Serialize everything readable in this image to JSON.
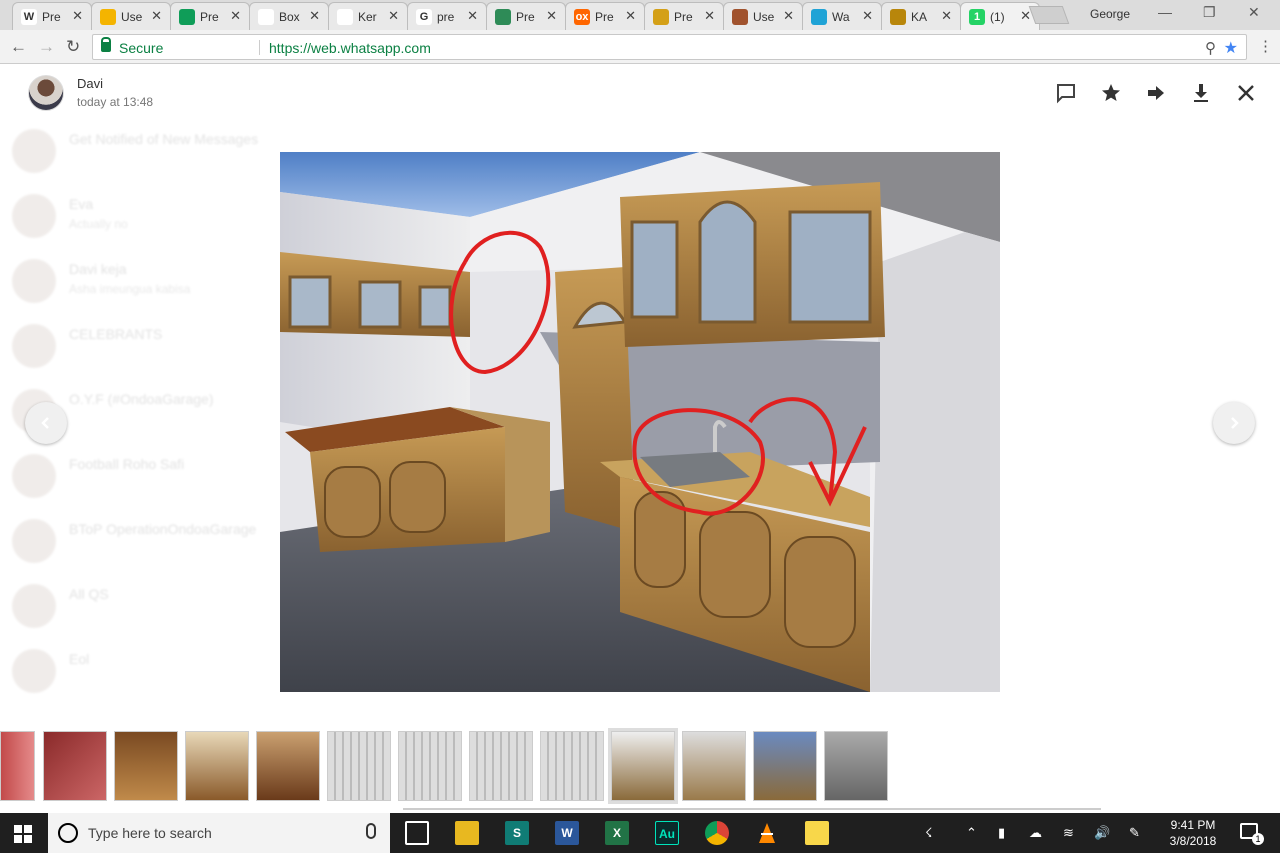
{
  "browser": {
    "tabs": [
      {
        "title": "Pre",
        "icon": "wikipedia-icon",
        "favicon_text": "W",
        "color": "#ffffff"
      },
      {
        "title": "Use",
        "icon": "drive-icon",
        "favicon_text": "",
        "color": "#f4b400"
      },
      {
        "title": "Pre",
        "icon": "drive-icon",
        "favicon_text": "",
        "color": "#0f9d58"
      },
      {
        "title": "Box",
        "icon": "document-icon",
        "favicon_text": "",
        "color": "#ffffff"
      },
      {
        "title": "Ker",
        "icon": "document-icon",
        "favicon_text": "",
        "color": "#ffffff"
      },
      {
        "title": "pre",
        "icon": "google-icon",
        "favicon_text": "G",
        "color": "#ffffff"
      },
      {
        "title": "Pre",
        "icon": "site-icon",
        "favicon_text": "",
        "color": "#2e8b57"
      },
      {
        "title": "Pre",
        "icon": "olx-icon",
        "favicon_text": "ox",
        "color": "#ff6600"
      },
      {
        "title": "Pre",
        "icon": "lion-icon",
        "favicon_text": "",
        "color": "#d4a017"
      },
      {
        "title": "Use",
        "icon": "puzzle-icon",
        "favicon_text": "",
        "color": "#a0522d"
      },
      {
        "title": "Wa",
        "icon": "play-icon",
        "favicon_text": "",
        "color": "#1fa3d6"
      },
      {
        "title": "KA",
        "icon": "shield-icon",
        "favicon_text": "",
        "color": "#b8860b"
      },
      {
        "title": "(1)",
        "icon": "whatsapp-icon",
        "favicon_text": "1",
        "color": "#25d366"
      }
    ],
    "profile_name": "George",
    "secure_label": "Secure",
    "url": "https://web.whatsapp.com"
  },
  "viewer": {
    "sender_name": "Davi",
    "sent_time": "today at 13:48",
    "actions": [
      "message-icon",
      "star-icon",
      "forward-icon",
      "download-icon",
      "close-icon"
    ]
  },
  "background_chats": [
    {
      "name": "Get Notified of New Messages",
      "message": ""
    },
    {
      "name": "Eva",
      "message": "Actually no"
    },
    {
      "name": "Davi keja",
      "message": "Asha imeungua kabisa"
    },
    {
      "name": "CELEBRANTS",
      "message": ""
    },
    {
      "name": "O.Y.F (#OndoaGarage)",
      "message": ""
    },
    {
      "name": "Football Roho Safi",
      "message": ""
    },
    {
      "name": "BToP OperationOndoaGarage",
      "message": ""
    },
    {
      "name": "All QS",
      "message": ""
    },
    {
      "name": "Eol",
      "message": ""
    }
  ],
  "thumbnails": [
    "room-red",
    "room-red2",
    "kitchen-wood",
    "kitchen-island",
    "kitchen-light",
    "plan",
    "plan",
    "plan",
    "plan",
    "render-kitchen",
    "render-kitchen2",
    "render-kitchen3",
    "render-kitchen4"
  ],
  "taskbar": {
    "search_placeholder": "Type here to search",
    "time": "9:41 PM",
    "date": "3/8/2018",
    "notification_count": "1"
  }
}
